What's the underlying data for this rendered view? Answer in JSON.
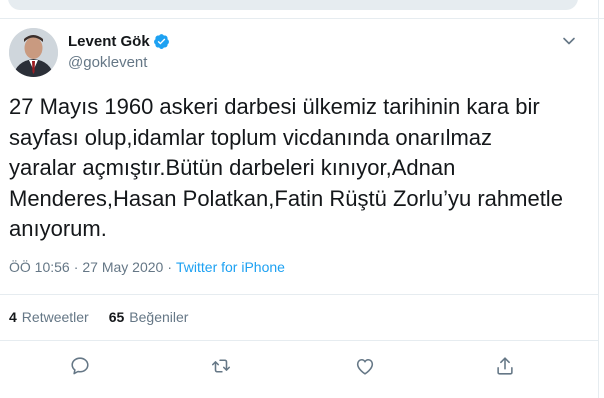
{
  "author": {
    "display_name": "Levent Gök",
    "handle": "@goklevent",
    "verified": true
  },
  "tweet": {
    "text": "27 Mayıs 1960 askeri darbesi ülkemiz tarihinin kara bir\nsayfası olup,idamlar toplum vicdanında onarılmaz\nyaralar açmıştır.Bütün darbeleri kınıyor,Adnan\nMenderes,Hasan Polatkan,Fatin Rüştü Zorlu’yu rahmetle\nanıyorum.",
    "time": "ÖÖ 10:56",
    "date": "27 May 2020",
    "separator": "·",
    "source": "Twitter for iPhone"
  },
  "stats": {
    "retweets_count": "4",
    "retweets_label": "Retweetler",
    "likes_count": "65",
    "likes_label": "Beğeniler"
  },
  "icons": {
    "reply": "reply-icon",
    "retweet": "retweet-icon",
    "like": "heart-icon",
    "share": "share-icon",
    "menu": "chevron-down-icon",
    "verified": "verified-badge-icon"
  },
  "colors": {
    "accent": "#1da1f2",
    "text": "#14171a",
    "muted": "#657786",
    "divider": "#e6ecf0"
  }
}
